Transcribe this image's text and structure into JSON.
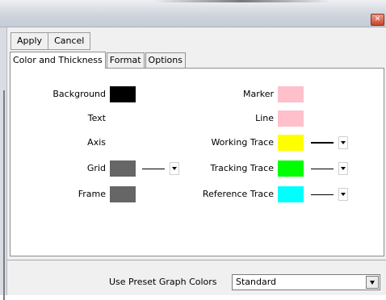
{
  "window": {
    "close_glyph": "✕"
  },
  "toolbar": {
    "apply_label": "Apply",
    "cancel_label": "Cancel"
  },
  "tabs": [
    {
      "label": "Color and Thickness",
      "active": true
    },
    {
      "label": "Format",
      "active": false
    },
    {
      "label": "Options",
      "active": false
    }
  ],
  "left_items": [
    {
      "label": "Background",
      "color": "#000000"
    },
    {
      "label": "Text",
      "color": "#ffffff"
    },
    {
      "label": "Axis",
      "color": "#ffffff"
    },
    {
      "label": "Grid",
      "color": "#666666",
      "has_line_style": true
    },
    {
      "label": "Frame",
      "color": "#666666"
    }
  ],
  "right_items": [
    {
      "label": "Marker",
      "color": "#ffc0cb"
    },
    {
      "label": "Line",
      "color": "#ffc0cb"
    },
    {
      "label": "Working Trace",
      "color": "#ffff00",
      "has_line_style": true
    },
    {
      "label": "Tracking Trace",
      "color": "#00ff00",
      "has_line_style": true
    },
    {
      "label": "Reference Trace",
      "color": "#00ffff",
      "has_line_style": true
    }
  ],
  "preset": {
    "label": "Use Preset Graph Colors",
    "value": "Standard"
  }
}
